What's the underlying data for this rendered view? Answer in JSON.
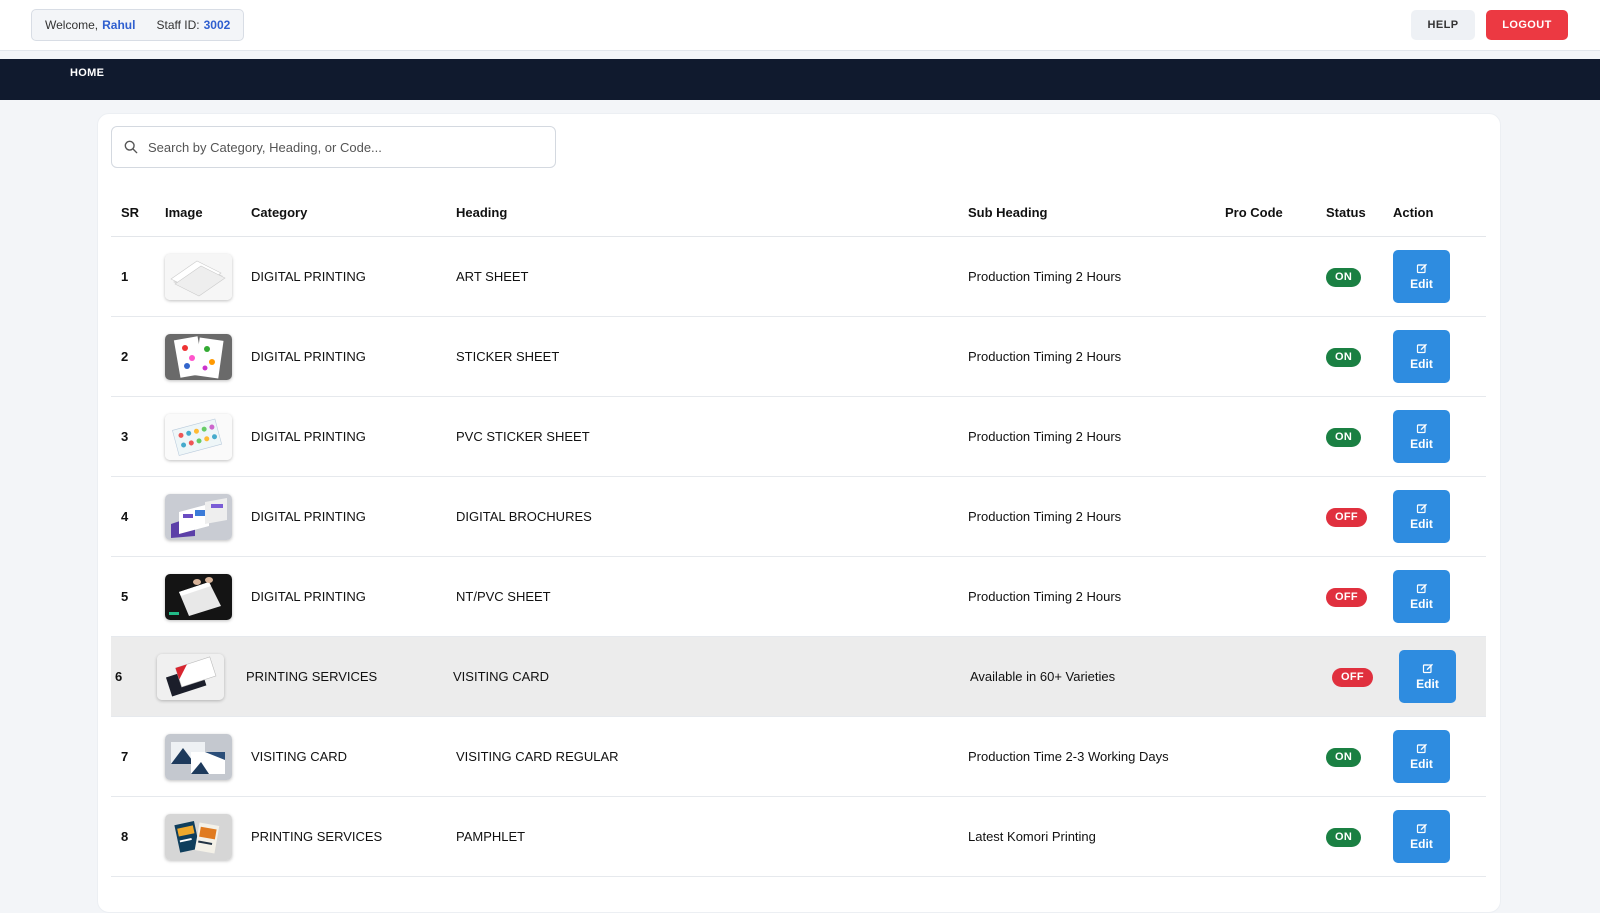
{
  "header": {
    "welcome_label": "Welcome,",
    "user_name": "Rahul",
    "staff_label": "Staff ID:",
    "staff_id": "3002",
    "help_label": "HELP",
    "logout_label": "LOGOUT"
  },
  "nav": {
    "home_label": "HOME"
  },
  "search": {
    "placeholder": "Search by Category, Heading, or Code..."
  },
  "table": {
    "headers": {
      "sr": "SR",
      "image": "Image",
      "category": "Category",
      "heading": "Heading",
      "sub_heading": "Sub Heading",
      "pro_code": "Pro Code",
      "status": "Status",
      "action": "Action"
    },
    "edit_label": "Edit",
    "rows": [
      {
        "sr": "1",
        "category": "DIGITAL PRINTING",
        "heading": "ART SHEET",
        "sub_heading": "Production Timing 2 Hours",
        "pro_code": "",
        "status": "ON",
        "image_icon": "art-sheet-image"
      },
      {
        "sr": "2",
        "category": "DIGITAL PRINTING",
        "heading": "STICKER SHEET",
        "sub_heading": "Production Timing 2 Hours",
        "pro_code": "",
        "status": "ON",
        "image_icon": "sticker-sheet-image"
      },
      {
        "sr": "3",
        "category": "DIGITAL PRINTING",
        "heading": "PVC STICKER SHEET",
        "sub_heading": "Production Timing 2 Hours",
        "pro_code": "",
        "status": "ON",
        "image_icon": "pvc-sticker-sheet-image"
      },
      {
        "sr": "4",
        "category": "DIGITAL PRINTING",
        "heading": "DIGITAL BROCHURES",
        "sub_heading": "Production Timing 2 Hours",
        "pro_code": "",
        "status": "OFF",
        "image_icon": "brochure-image"
      },
      {
        "sr": "5",
        "category": "DIGITAL PRINTING",
        "heading": "NT/PVC SHEET",
        "sub_heading": "Production Timing 2 Hours",
        "pro_code": "",
        "status": "OFF",
        "image_icon": "nt-pvc-sheet-image"
      },
      {
        "sr": "6",
        "category": "PRINTING SERVICES",
        "heading": "VISITING CARD",
        "sub_heading": "Available in 60+ Varieties",
        "pro_code": "",
        "status": "OFF",
        "image_icon": "visiting-card-image"
      },
      {
        "sr": "7",
        "category": "VISITING CARD",
        "heading": "VISITING CARD REGULAR",
        "sub_heading": "Production Time 2-3 Working Days",
        "pro_code": "",
        "status": "ON",
        "image_icon": "visiting-card-regular-image"
      },
      {
        "sr": "8",
        "category": "PRINTING SERVICES",
        "heading": "PAMPHLET",
        "sub_heading": "Latest Komori Printing",
        "pro_code": "",
        "status": "ON",
        "image_icon": "pamphlet-image"
      }
    ]
  },
  "colors": {
    "nav_bg": "#101a2e",
    "logout": "#ec3942",
    "edit": "#2e8ce0",
    "status_on": "#1a8043",
    "status_off": "#e0303e",
    "accent_text": "#2f5fcf"
  }
}
